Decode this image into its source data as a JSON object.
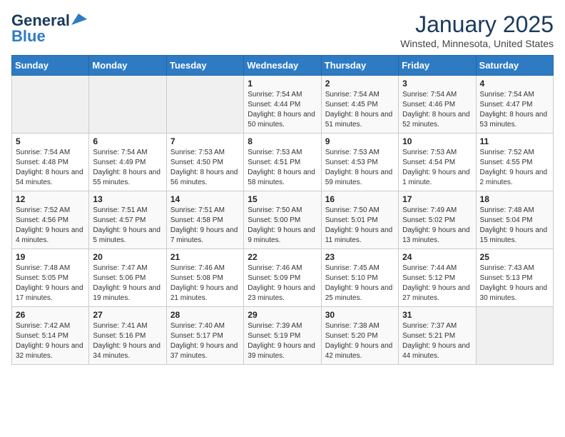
{
  "logo": {
    "line1": "General",
    "line2": "Blue"
  },
  "header": {
    "month": "January 2025",
    "location": "Winsted, Minnesota, United States"
  },
  "weekdays": [
    "Sunday",
    "Monday",
    "Tuesday",
    "Wednesday",
    "Thursday",
    "Friday",
    "Saturday"
  ],
  "weeks": [
    [
      {
        "day": "",
        "content": ""
      },
      {
        "day": "",
        "content": ""
      },
      {
        "day": "",
        "content": ""
      },
      {
        "day": "1",
        "content": "Sunrise: 7:54 AM\nSunset: 4:44 PM\nDaylight: 8 hours\nand 50 minutes."
      },
      {
        "day": "2",
        "content": "Sunrise: 7:54 AM\nSunset: 4:45 PM\nDaylight: 8 hours\nand 51 minutes."
      },
      {
        "day": "3",
        "content": "Sunrise: 7:54 AM\nSunset: 4:46 PM\nDaylight: 8 hours\nand 52 minutes."
      },
      {
        "day": "4",
        "content": "Sunrise: 7:54 AM\nSunset: 4:47 PM\nDaylight: 8 hours\nand 53 minutes."
      }
    ],
    [
      {
        "day": "5",
        "content": "Sunrise: 7:54 AM\nSunset: 4:48 PM\nDaylight: 8 hours\nand 54 minutes."
      },
      {
        "day": "6",
        "content": "Sunrise: 7:54 AM\nSunset: 4:49 PM\nDaylight: 8 hours\nand 55 minutes."
      },
      {
        "day": "7",
        "content": "Sunrise: 7:53 AM\nSunset: 4:50 PM\nDaylight: 8 hours\nand 56 minutes."
      },
      {
        "day": "8",
        "content": "Sunrise: 7:53 AM\nSunset: 4:51 PM\nDaylight: 8 hours\nand 58 minutes."
      },
      {
        "day": "9",
        "content": "Sunrise: 7:53 AM\nSunset: 4:53 PM\nDaylight: 8 hours\nand 59 minutes."
      },
      {
        "day": "10",
        "content": "Sunrise: 7:53 AM\nSunset: 4:54 PM\nDaylight: 9 hours\nand 1 minute."
      },
      {
        "day": "11",
        "content": "Sunrise: 7:52 AM\nSunset: 4:55 PM\nDaylight: 9 hours\nand 2 minutes."
      }
    ],
    [
      {
        "day": "12",
        "content": "Sunrise: 7:52 AM\nSunset: 4:56 PM\nDaylight: 9 hours\nand 4 minutes."
      },
      {
        "day": "13",
        "content": "Sunrise: 7:51 AM\nSunset: 4:57 PM\nDaylight: 9 hours\nand 5 minutes."
      },
      {
        "day": "14",
        "content": "Sunrise: 7:51 AM\nSunset: 4:58 PM\nDaylight: 9 hours\nand 7 minutes."
      },
      {
        "day": "15",
        "content": "Sunrise: 7:50 AM\nSunset: 5:00 PM\nDaylight: 9 hours\nand 9 minutes."
      },
      {
        "day": "16",
        "content": "Sunrise: 7:50 AM\nSunset: 5:01 PM\nDaylight: 9 hours\nand 11 minutes."
      },
      {
        "day": "17",
        "content": "Sunrise: 7:49 AM\nSunset: 5:02 PM\nDaylight: 9 hours\nand 13 minutes."
      },
      {
        "day": "18",
        "content": "Sunrise: 7:48 AM\nSunset: 5:04 PM\nDaylight: 9 hours\nand 15 minutes."
      }
    ],
    [
      {
        "day": "19",
        "content": "Sunrise: 7:48 AM\nSunset: 5:05 PM\nDaylight: 9 hours\nand 17 minutes."
      },
      {
        "day": "20",
        "content": "Sunrise: 7:47 AM\nSunset: 5:06 PM\nDaylight: 9 hours\nand 19 minutes."
      },
      {
        "day": "21",
        "content": "Sunrise: 7:46 AM\nSunset: 5:08 PM\nDaylight: 9 hours\nand 21 minutes."
      },
      {
        "day": "22",
        "content": "Sunrise: 7:46 AM\nSunset: 5:09 PM\nDaylight: 9 hours\nand 23 minutes."
      },
      {
        "day": "23",
        "content": "Sunrise: 7:45 AM\nSunset: 5:10 PM\nDaylight: 9 hours\nand 25 minutes."
      },
      {
        "day": "24",
        "content": "Sunrise: 7:44 AM\nSunset: 5:12 PM\nDaylight: 9 hours\nand 27 minutes."
      },
      {
        "day": "25",
        "content": "Sunrise: 7:43 AM\nSunset: 5:13 PM\nDaylight: 9 hours\nand 30 minutes."
      }
    ],
    [
      {
        "day": "26",
        "content": "Sunrise: 7:42 AM\nSunset: 5:14 PM\nDaylight: 9 hours\nand 32 minutes."
      },
      {
        "day": "27",
        "content": "Sunrise: 7:41 AM\nSunset: 5:16 PM\nDaylight: 9 hours\nand 34 minutes."
      },
      {
        "day": "28",
        "content": "Sunrise: 7:40 AM\nSunset: 5:17 PM\nDaylight: 9 hours\nand 37 minutes."
      },
      {
        "day": "29",
        "content": "Sunrise: 7:39 AM\nSunset: 5:19 PM\nDaylight: 9 hours\nand 39 minutes."
      },
      {
        "day": "30",
        "content": "Sunrise: 7:38 AM\nSunset: 5:20 PM\nDaylight: 9 hours\nand 42 minutes."
      },
      {
        "day": "31",
        "content": "Sunrise: 7:37 AM\nSunset: 5:21 PM\nDaylight: 9 hours\nand 44 minutes."
      },
      {
        "day": "",
        "content": ""
      }
    ]
  ]
}
